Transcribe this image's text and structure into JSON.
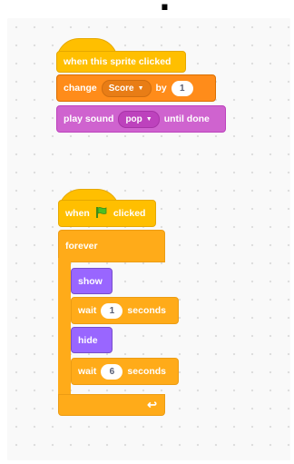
{
  "script1": {
    "hat_label": "when this sprite clicked",
    "change_label": "change",
    "change_var": "Score",
    "change_by": "by",
    "change_value": "1",
    "play_label": "play sound",
    "sound_name": "pop",
    "until_done": "until done"
  },
  "script2": {
    "when_label": "when",
    "clicked_label": "clicked",
    "forever_label": "forever",
    "show_label": "show",
    "wait1_label": "wait",
    "wait1_value": "1",
    "wait1_unit": "seconds",
    "hide_label": "hide",
    "wait2_label": "wait",
    "wait2_value": "6",
    "wait2_unit": "seconds",
    "loop_arrow": "↩"
  },
  "colors": {
    "events": "#ffbf00",
    "control": "#ffab19",
    "variables": "#ff8c1a",
    "sound": "#cf63cf",
    "looks": "#9966ff"
  },
  "icons": {
    "green_flag": "green-flag-icon",
    "dropdown": "caret-down-icon"
  }
}
